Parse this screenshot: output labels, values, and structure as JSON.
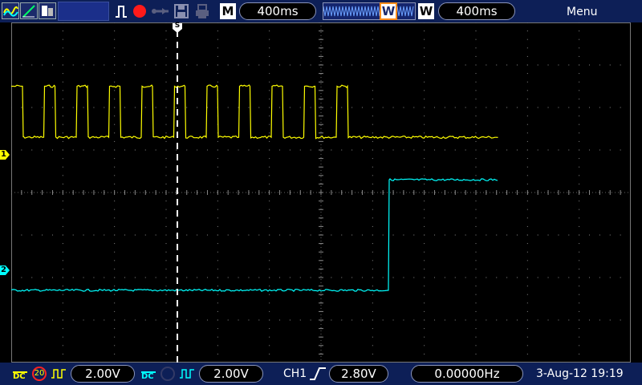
{
  "top_bar": {
    "icons": [
      "ch1-wave-icon",
      "ch2-slope-icon",
      "measure-icon",
      "run-pulse-icon",
      "record-dot-icon",
      "usb-icon",
      "save-icon",
      "print-icon"
    ],
    "timebase_mode": "M",
    "timebase_value": "400ms",
    "window_mode": "W",
    "window_value": "400ms",
    "menu_label": "Menu",
    "trigger_marker": "S"
  },
  "channels": [
    {
      "id": "1",
      "color": "#ffff00",
      "coupling": "DC",
      "bw_limit": "20",
      "scale": "2.00V"
    },
    {
      "id": "2",
      "color": "#00ffff",
      "coupling": "DC",
      "scale": "2.00V"
    }
  ],
  "trigger": {
    "source": "CH1",
    "slope": "rising",
    "level": "2.80V",
    "frequency": "0.00000Hz"
  },
  "datetime": "3-Aug-12 19:19",
  "colors": {
    "ch1": "#ffff00",
    "ch2": "#00ffff",
    "bar": "#0d1f57",
    "trigger_outline": "#ff8c1a"
  },
  "waveforms": {
    "ch1": {
      "type": "square",
      "high_div": 2.5,
      "low_div": 1.3,
      "pulses": 11,
      "end_state": "low"
    },
    "ch2": {
      "type": "step",
      "low_div": -2.3,
      "high_div": 0.3
    }
  }
}
